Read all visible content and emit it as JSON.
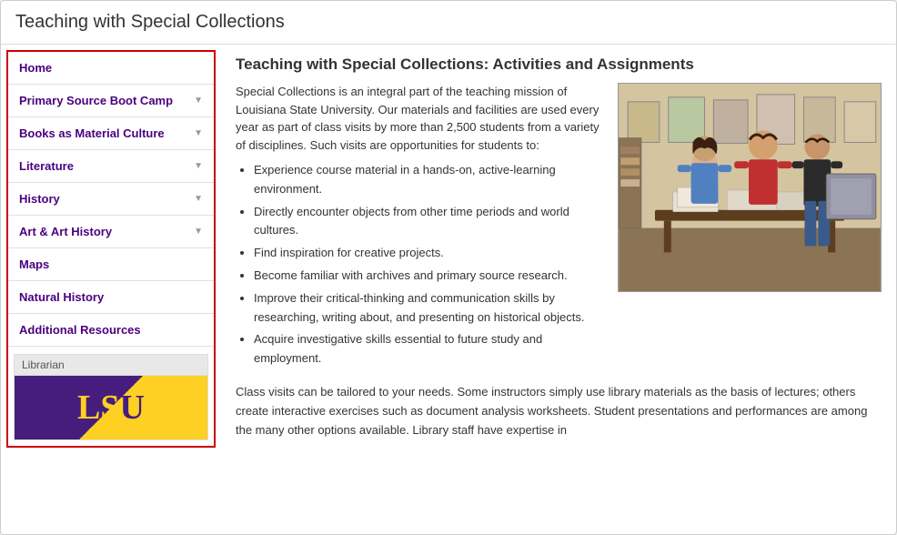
{
  "page": {
    "title": "Teaching with Special Collections"
  },
  "sidebar": {
    "nav_items": [
      {
        "label": "Home",
        "has_chevron": false,
        "active": true
      },
      {
        "label": "Primary Source Boot Camp",
        "has_chevron": true,
        "active": false
      },
      {
        "label": "Books as Material Culture",
        "has_chevron": true,
        "active": false
      },
      {
        "label": "Literature",
        "has_chevron": true,
        "active": false
      },
      {
        "label": "History",
        "has_chevron": true,
        "active": false
      },
      {
        "label": "Art & Art History",
        "has_chevron": true,
        "active": false
      },
      {
        "label": "Maps",
        "has_chevron": false,
        "active": false
      },
      {
        "label": "Natural History",
        "has_chevron": false,
        "active": false
      },
      {
        "label": "Additional Resources",
        "has_chevron": false,
        "active": false
      }
    ],
    "librarian_label": "Librarian",
    "librarian_logo_text": "LSU"
  },
  "main": {
    "heading": "Teaching with Special Collections: Activities and Assignments",
    "intro_paragraph": "Special Collections is an integral part of the teaching mission of Louisiana State University. Our materials and facilities are used every year as part of class visits by more than 2,500 students from a variety of disciplines. Such visits are opportunities for students to:",
    "bullet_points": [
      "Experience course material in a hands-on, active-learning environment.",
      "Directly encounter objects from other time periods and world cultures.",
      "Find inspiration for creative projects.",
      "Become familiar with archives and primary source research.",
      "Improve their critical-thinking and communication skills by researching, writing about, and presenting on historical objects.",
      "Acquire investigative skills essential to future study and employment."
    ],
    "bottom_paragraph": "Class visits can be tailored to your needs. Some instructors simply use library materials as the basis of lectures; others create interactive exercises such as document analysis worksheets. Student presentations and performances are among the many other options available. Library staff have expertise in"
  }
}
